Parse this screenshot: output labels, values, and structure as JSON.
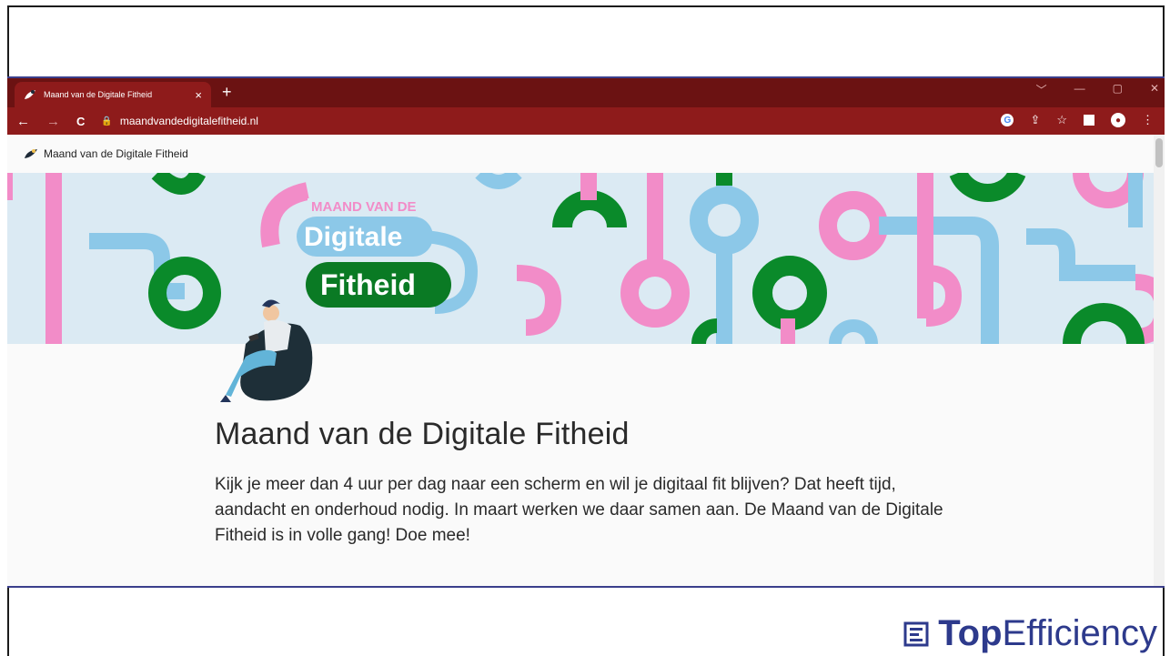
{
  "browser": {
    "tab_title": "Maand van de Digitale Fitheid",
    "tab_close": "×",
    "new_tab": "+",
    "url": "maandvandedigitalefitheid.nl",
    "window_controls": [
      "﹀",
      "—",
      "▢",
      "✕"
    ]
  },
  "toolbar": {
    "back_icon": "←",
    "forward_icon": "→",
    "reload_icon": "C",
    "lock_icon": "🔒",
    "google_icon": "G",
    "share_icon": "⇪",
    "star_icon": "☆",
    "avatar_icon": "●",
    "menu_icon": "⋮"
  },
  "site": {
    "header_title": "Maand van de Digitale Fitheid",
    "banner_logo_line1": "MAAND VAN DE",
    "banner_logo_line2": "Digitale",
    "banner_logo_line3": "Fitheid",
    "page_title": "Maand van de Digitale Fitheid",
    "intro": "Kijk je meer dan 4 uur per dag naar een scherm en wil je digitaal fit blijven? Dat heeft tijd, aandacht en onderhoud nodig. In maart werken we daar samen aan. De Maand van de Digitale Fitheid is in volle gang! Doe mee!"
  },
  "brand": {
    "top": "Top",
    "efficiency": "Efficiency"
  },
  "colors": {
    "tabbar": "#6b1212",
    "toolbar": "#8e1b1b",
    "banner_bg": "#dbeaf3",
    "green": "#0a8a2a",
    "pink": "#f28cc8",
    "blue": "#8cc8e8",
    "brand": "#2d3a8c"
  }
}
